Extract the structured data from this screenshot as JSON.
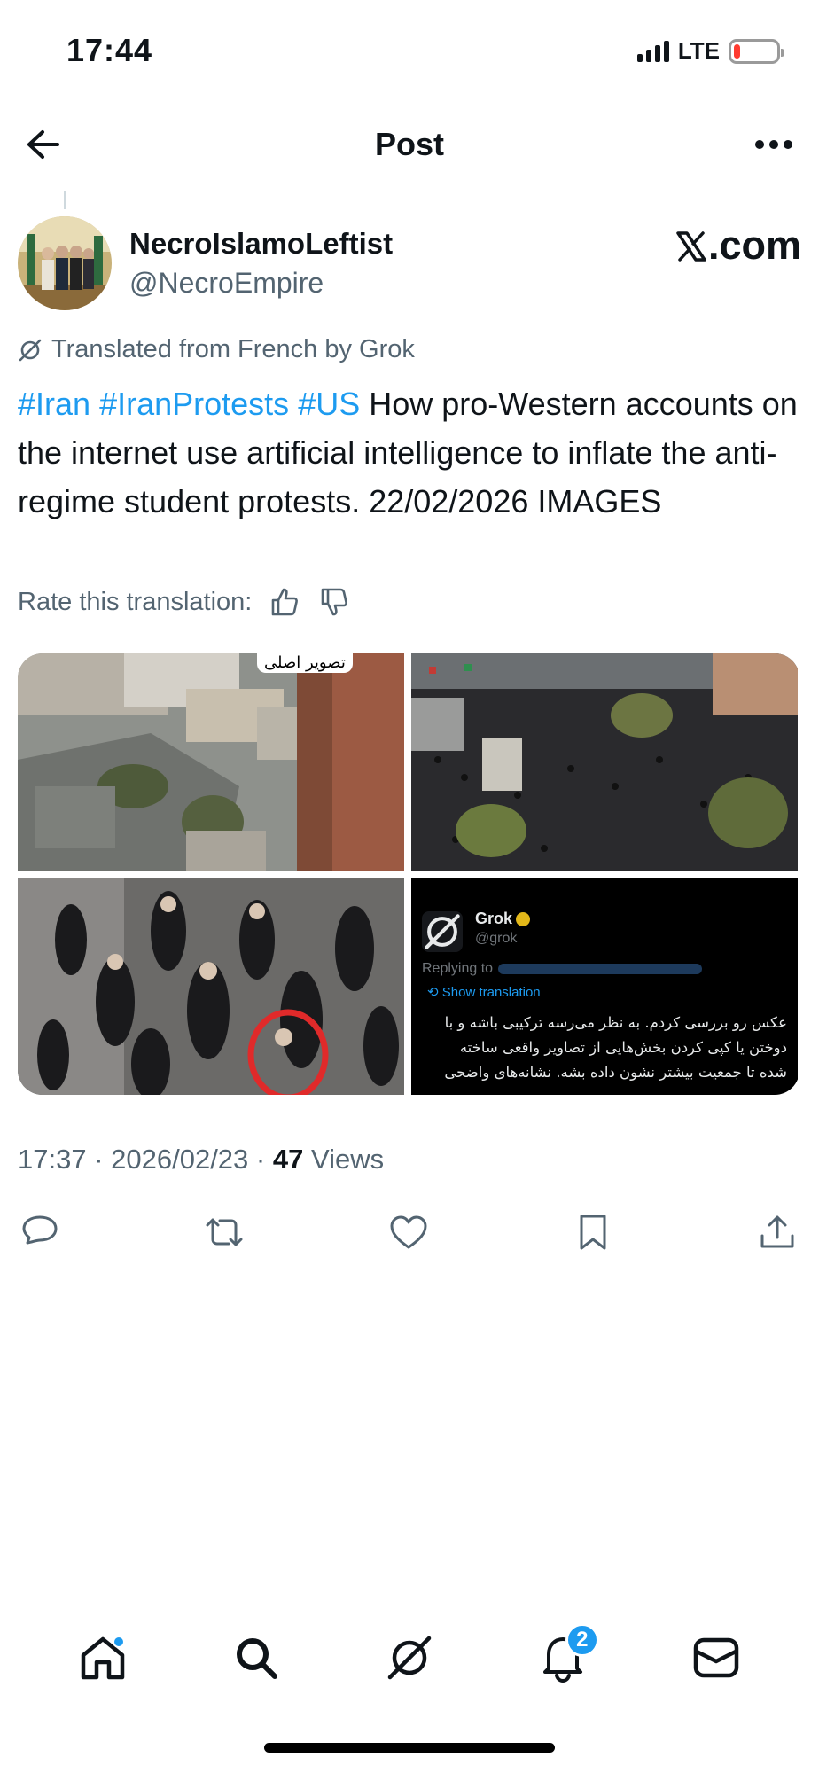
{
  "status_bar": {
    "time": "17:44",
    "network": "LTE",
    "battery_level": 0.15,
    "battery_color": "#ff3b30"
  },
  "header": {
    "title": "Post",
    "back_icon": "arrow-left-icon",
    "more_icon": "more-horizontal-icon"
  },
  "author": {
    "display_name": "NecroIslamoLeftist",
    "handle": "@NecroEmpire",
    "source_label": ".com",
    "source_logo": "x-logo-icon"
  },
  "translation": {
    "label": "Translated from French by Grok",
    "rate_label": "Rate this translation:"
  },
  "post": {
    "hashtags": [
      "#Iran",
      "#IranProtests",
      "#US"
    ],
    "body": "How pro-Western accounts on the internet use artificial intelligence to inflate the anti-regime student protests. 22/02/2026 IMAGES"
  },
  "media": {
    "image1_caption": "تصویر اصلی",
    "grok_shot": {
      "name": "Grok",
      "handle": "@grok",
      "replying_to": "Replying to",
      "show_translation": "Show translation",
      "text_lines": [
        "عکس رو بررسی کردم. به نظر می‌رسه ترکیبی باشه و با",
        "دوختن یا کپی کردن بخش‌هایی از تصاویر واقعی ساخته",
        "شده تا جمعیت بیشتر نشون داده بشه. نشانه‌های واضحی"
      ]
    }
  },
  "meta": {
    "time": "17:37",
    "date": "2026/02/23",
    "views_count": "47",
    "views_label": "Views"
  },
  "nav": {
    "notification_count": "2",
    "accent": "#1d9bf0"
  }
}
